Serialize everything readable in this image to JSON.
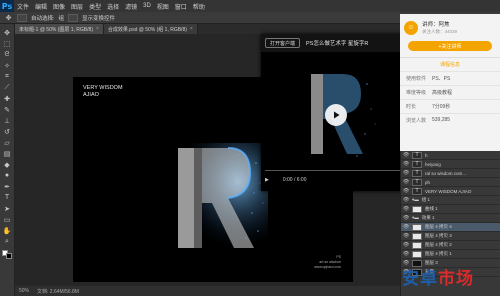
{
  "app": {
    "logo": "Ps"
  },
  "menubar": {
    "items": [
      "文件",
      "编辑",
      "图像",
      "图层",
      "类型",
      "选择",
      "滤镜",
      "3D",
      "视图",
      "窗口",
      "帮助"
    ]
  },
  "optbar": {
    "auto_select_label": "自动选择:",
    "layer_label": "组",
    "show_transform_label": "显示变换控件"
  },
  "tabs": [
    {
      "label": "未标题-1 @ 50% (图层 1, RGB/8)",
      "close": "×"
    },
    {
      "label": "合成效果.psd @ 50% (组 1, RGB/8)",
      "close": "×"
    }
  ],
  "artwork": {
    "title_line1": "VERY WISDOM",
    "title_line2": "AJIAO",
    "caption_line1": "PS",
    "caption_line2": "art.so wisdom",
    "caption_line3": "www.qqhard.com"
  },
  "video": {
    "open_client": "打开客户端",
    "title": "PS怎么做艺术字 星旋字R",
    "time": "0:00 / 6:00"
  },
  "info": {
    "author_name": "讲师：阿焦",
    "author_sub": "关注人数：44039",
    "follow_btn": "+关注讲师",
    "section_title": "课程信息",
    "rows": [
      {
        "key": "使用软件",
        "val": "PS、PS"
      },
      {
        "key": "难度等级",
        "val": "高级教程"
      },
      {
        "key": "时长",
        "val": "7分09秒"
      },
      {
        "key": "浏览人数",
        "val": "539,285"
      }
    ]
  },
  "layers": [
    {
      "name": "h"
    },
    {
      "name": "heiyang"
    },
    {
      "name": "ral so wisdom.com..."
    },
    {
      "name": "ph"
    },
    {
      "name": "VERY WISDOM AJIAO"
    },
    {
      "name": "组 1"
    },
    {
      "name": "曲线 1"
    },
    {
      "name": "效果 1"
    },
    {
      "name": "图层 4 拷贝 4"
    },
    {
      "name": "图层 4 拷贝 3"
    },
    {
      "name": "图层 4 拷贝 2"
    },
    {
      "name": "图层 4 拷贝 1"
    },
    {
      "name": "图层 3"
    },
    {
      "name": "背景"
    }
  ],
  "statusbar": {
    "zoom": "50%",
    "doc": "文档: 2.64M/56.8M"
  },
  "watermark": {
    "char1": "安",
    "char2": "卓",
    "char3": "市",
    "char4": "场"
  },
  "colors": {
    "accent": "#f4a400",
    "ps_blue": "#31a8ff",
    "wm_blue": "#1e5ea8",
    "wm_red": "#d92b2b"
  }
}
